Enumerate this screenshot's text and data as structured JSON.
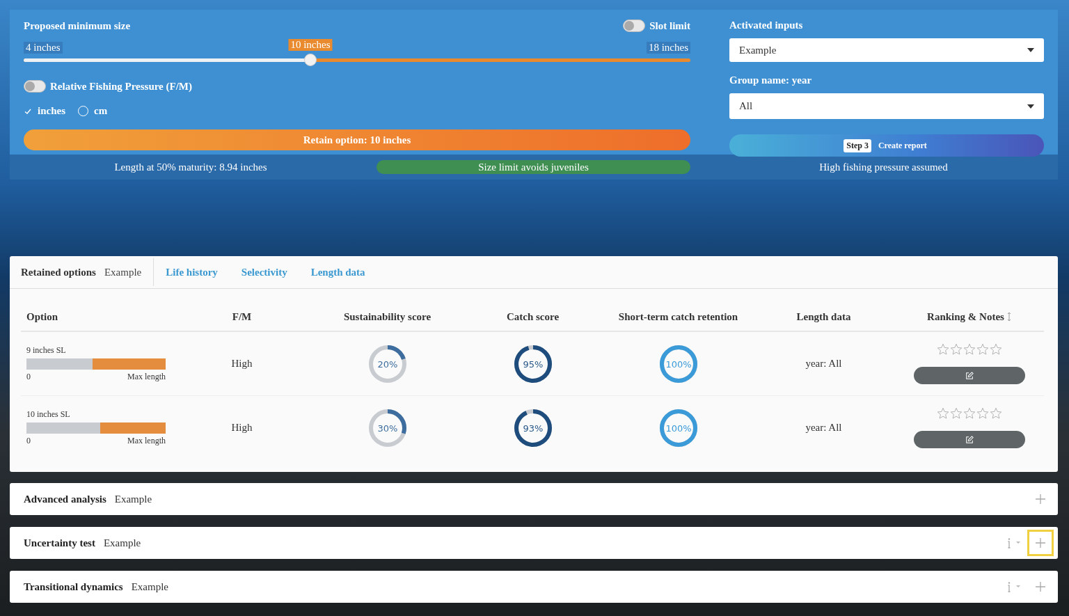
{
  "controls": {
    "title": "Proposed minimum size",
    "slot_limit": {
      "label": "Slot limit",
      "on": false
    },
    "slider": {
      "min_label": "4 inches",
      "value_label": "10 inches",
      "max_label": "18 inches",
      "level": 0.43
    },
    "fishing_pressure": {
      "label": "Relative Fishing Pressure (F/M)",
      "on": false
    },
    "units": [
      {
        "label": "inches",
        "selected": true
      },
      {
        "label": "cm",
        "selected": false
      }
    ],
    "retain_button": "Retain option: 10 inches"
  },
  "inputs": {
    "activated_label": "Activated inputs",
    "activated_value": "Example",
    "group_label": "Group name: year",
    "group_value": "All",
    "report_step": "Step 3",
    "report_button": "Create report"
  },
  "status_bar": {
    "maturity": "Length at 50% maturity: 8.94 inches",
    "juveniles": "Size limit avoids juveniles",
    "pressure": "High fishing pressure assumed"
  },
  "tabs": [
    {
      "label": "Retained options",
      "subtitle": "Example",
      "selected": true
    },
    {
      "label": "Life history",
      "selected": false
    },
    {
      "label": "Selectivity",
      "selected": false
    },
    {
      "label": "Length data",
      "selected": false
    }
  ],
  "table": {
    "columns": [
      "Option",
      "F/M",
      "Sustainability score",
      "Catch score",
      "Short-term catch retention",
      "Length data",
      "Ranking & Notes"
    ],
    "rows": [
      {
        "option": "9 inches SL",
        "bar": {
          "level": 0.475
        },
        "bar_min": "0",
        "bar_max": "Max length",
        "fm": "High",
        "sustainability": {
          "text": "20%",
          "level": 0.2
        },
        "catch": {
          "text": "95%",
          "level": 0.95
        },
        "retention": {
          "text": "100%",
          "level": 1.0
        },
        "length_data": "year: All",
        "stars": 0
      },
      {
        "option": "10 inches SL",
        "bar": {
          "level": 0.53
        },
        "bar_min": "0",
        "bar_max": "Max length",
        "fm": "High",
        "sustainability": {
          "text": "30%",
          "level": 0.3
        },
        "catch": {
          "text": "93%",
          "level": 0.93
        },
        "retention": {
          "text": "100%",
          "level": 1.0
        },
        "length_data": "year: All",
        "stars": 0
      }
    ]
  },
  "sections": [
    {
      "title": "Advanced analysis",
      "subtitle": "Example",
      "info": false,
      "highlighted": false
    },
    {
      "title": "Uncertainty test",
      "subtitle": "Example",
      "info": true,
      "highlighted": true
    },
    {
      "title": "Transitional dynamics",
      "subtitle": "Example",
      "info": true,
      "highlighted": false
    }
  ]
}
